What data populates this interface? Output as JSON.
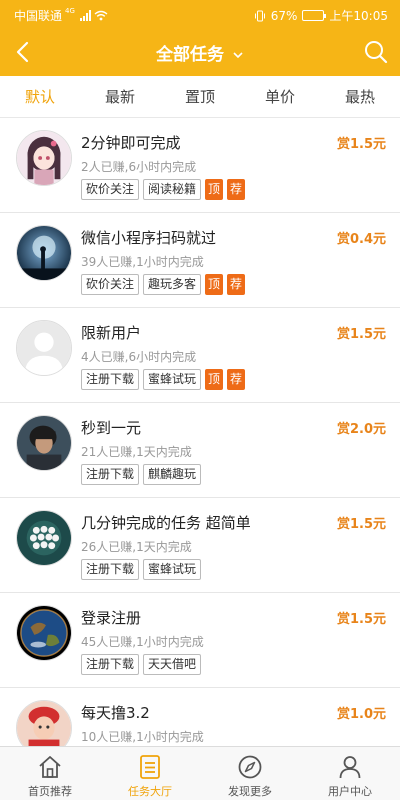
{
  "status_bar": {
    "carrier": "中国联通",
    "network": "4G",
    "battery": "67%",
    "battery_level": 0.67,
    "time": "上午10:05"
  },
  "header": {
    "title": "全部任务",
    "back_icon": "chevron-left-icon",
    "search_icon": "search-icon"
  },
  "tabs": [
    {
      "label": "默认",
      "active": true
    },
    {
      "label": "最新",
      "active": false
    },
    {
      "label": "置顶",
      "active": false
    },
    {
      "label": "单价",
      "active": false
    },
    {
      "label": "最热",
      "active": false
    }
  ],
  "tasks": [
    {
      "title": "2分钟即可完成",
      "meta": "2人已赚,6小时内完成",
      "reward": "赏1.5元",
      "tags": [
        "砍价关注",
        "阅读秘籍"
      ],
      "flags": [
        "顶",
        "荐"
      ],
      "avatar": "anime-girl-avatar"
    },
    {
      "title": "微信小程序扫码就过",
      "meta": "39人已赚,1小时内完成",
      "reward": "赏0.4元",
      "tags": [
        "砍价关注",
        "趣玩多客"
      ],
      "flags": [
        "顶",
        "荐"
      ],
      "avatar": "night-sky-avatar"
    },
    {
      "title": "限新用户",
      "meta": "4人已赚,6小时内完成",
      "reward": "赏1.5元",
      "tags": [
        "注册下载",
        "蜜蜂试玩"
      ],
      "flags": [
        "顶",
        "荐"
      ],
      "avatar": "default-user-avatar"
    },
    {
      "title": "秒到一元",
      "meta": "21人已赚,1天内完成",
      "reward": "赏2.0元",
      "tags": [
        "注册下载",
        "麒麟趣玩"
      ],
      "flags": [],
      "avatar": "man-portrait-avatar"
    },
    {
      "title": "几分钟完成的任务 超简单",
      "meta": "26人已赚,1天内完成",
      "reward": "赏1.5元",
      "tags": [
        "注册下载",
        "蜜蜂试玩"
      ],
      "flags": [],
      "avatar": "pearls-avatar"
    },
    {
      "title": "登录注册",
      "meta": "45人已赚,1小时内完成",
      "reward": "赏1.5元",
      "tags": [
        "注册下载",
        "天天借吧"
      ],
      "flags": [],
      "avatar": "earth-avatar"
    },
    {
      "title": "每天撸3.2",
      "meta": "10人已赚,1小时内完成",
      "reward": "赏1.0元",
      "tags": [],
      "flags": [],
      "avatar": "child-avatar"
    }
  ],
  "bottom_nav": [
    {
      "label": "首页推荐",
      "icon": "home-icon",
      "active": false
    },
    {
      "label": "任务大厅",
      "icon": "task-list-icon",
      "active": true
    },
    {
      "label": "发现更多",
      "icon": "compass-icon",
      "active": false
    },
    {
      "label": "用户中心",
      "icon": "user-icon",
      "active": false
    }
  ],
  "colors": {
    "brand": "#F6B516",
    "accent": "#F0A30A",
    "reward": "#E8841A",
    "flag": "#EE6B17"
  }
}
